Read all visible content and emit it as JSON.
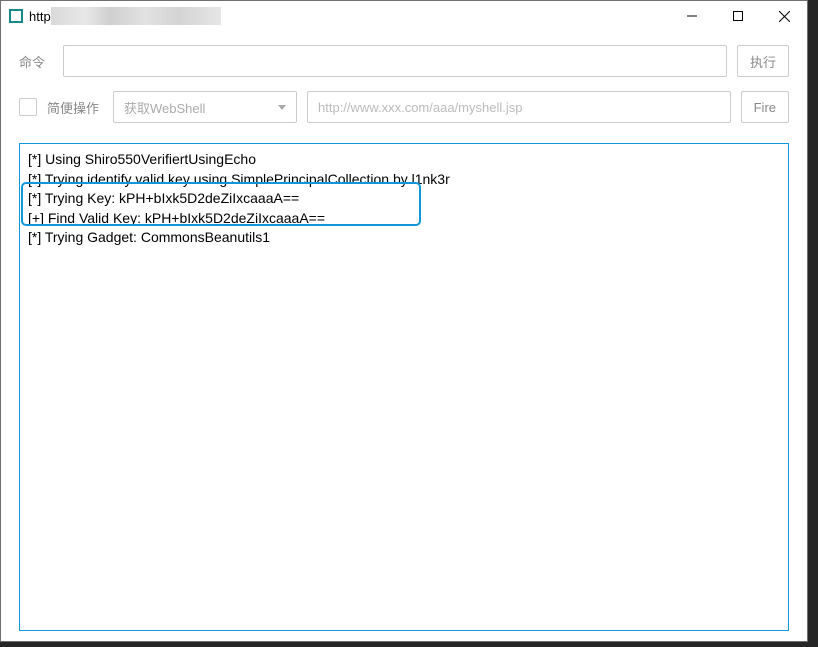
{
  "titlebar": {
    "title_prefix": "http"
  },
  "row_cmd": {
    "label": "命令",
    "exec_button": "执行"
  },
  "row_ops": {
    "checkbox_label": "简便操作",
    "select_value": "获取WebShell",
    "url_placeholder": "http://www.xxx.com/aaa/myshell.jsp",
    "fire_button": "Fire"
  },
  "output": {
    "lines": [
      "[*] Using Shiro550VerifiertUsingEcho",
      "[*] Trying identify valid key using SimplePrincipalCollection by l1nk3r",
      "[*] Trying Key: kPH+bIxk5D2deZiIxcaaaA==",
      "[+] Find Valid Key: kPH+bIxk5D2deZiIxcaaaA==",
      "[*] Trying Gadget: CommonsBeanutils1"
    ]
  }
}
